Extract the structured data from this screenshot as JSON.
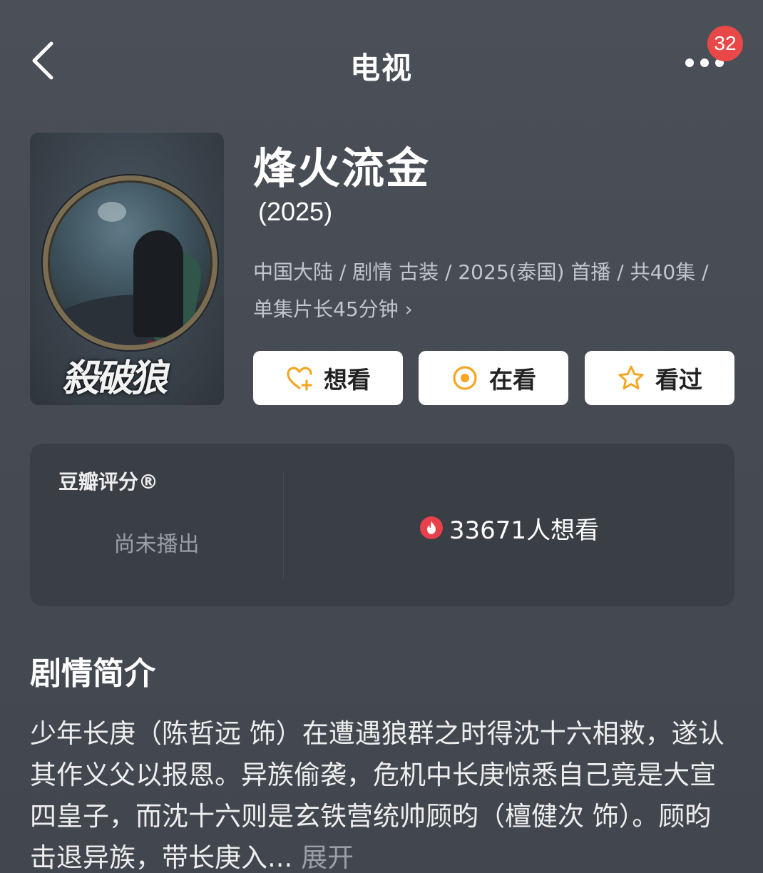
{
  "header": {
    "title": "电视",
    "badge_count": "32"
  },
  "show": {
    "title": "烽火流金",
    "year": "(2025)",
    "poster_text": "殺破狼",
    "meta": "中国大陆 / 剧情 古装 / 2025(泰国) 首播 / 共40集 / 单集片长45分钟",
    "meta_chevron": "›"
  },
  "actions": [
    {
      "label": "想看",
      "icon": "heart-plus-icon"
    },
    {
      "label": "在看",
      "icon": "circle-dot-icon"
    },
    {
      "label": "看过",
      "icon": "star-icon"
    }
  ],
  "rating": {
    "label": "豆瓣评分®",
    "status": "尚未播出",
    "wish_count": "33671人想看",
    "fire_icon": "fire-icon"
  },
  "synopsis": {
    "title": "剧情简介",
    "text": "少年长庚（陈哲远 饰）在遭遇狼群之时得沈十六相救，遂认其作义父以报恩。异族偷袭，危机中长庚惊悉自己竟是大宣四皇子，而沈十六则是玄铁营统帅顾昀（檀健次 饰）。顾昀击退异族，带长庚入...",
    "expand_label": "展开"
  },
  "colors": {
    "accent_orange": "#f5a623",
    "badge_red": "#e84848",
    "fire_red": "#e8404a"
  }
}
